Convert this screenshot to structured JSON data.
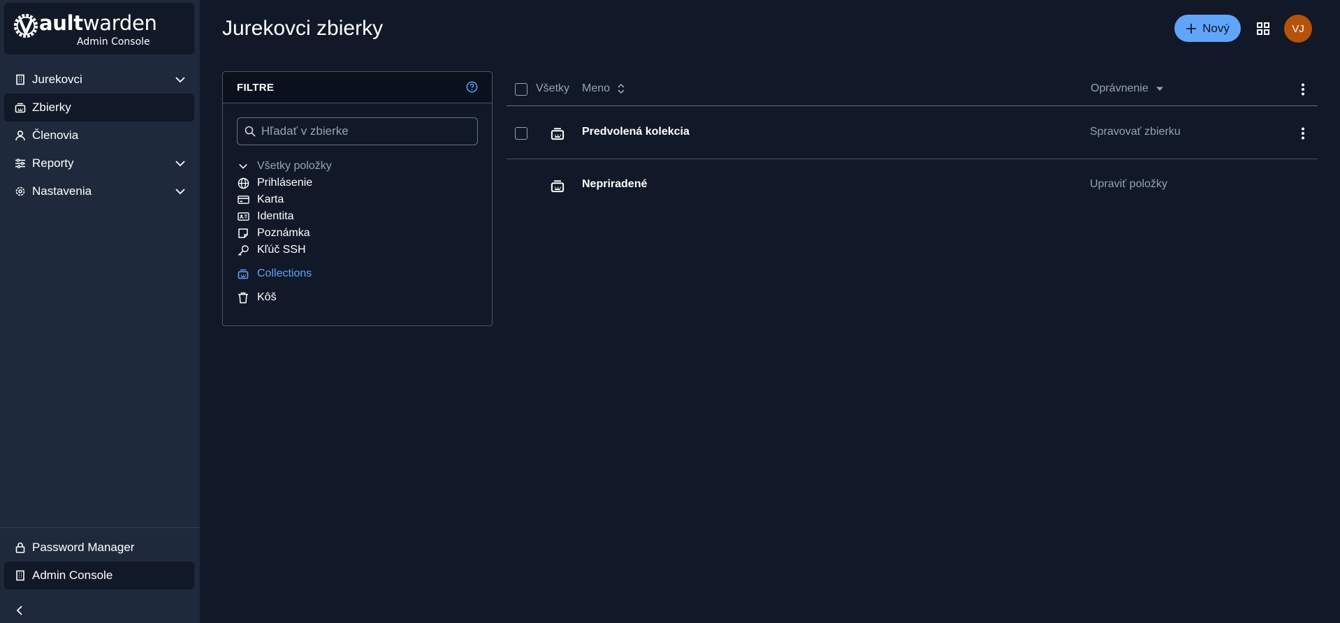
{
  "brand": {
    "name_bold": "ault",
    "name_rest": "warden",
    "subtitle": "Admin Console"
  },
  "sidebar": {
    "items": [
      {
        "label": "Jurekovci",
        "icon": "building-icon",
        "expandable": true
      },
      {
        "label": "Zbierky",
        "icon": "collection-icon",
        "active": true
      },
      {
        "label": "Členovia",
        "icon": "person-icon"
      },
      {
        "label": "Reporty",
        "icon": "sliders-icon",
        "expandable": true
      },
      {
        "label": "Nastavenia",
        "icon": "gear-icon",
        "expandable": true
      }
    ],
    "bottom": [
      {
        "label": "Password Manager",
        "icon": "lock-icon"
      },
      {
        "label": "Admin Console",
        "icon": "building-icon",
        "active": true
      }
    ]
  },
  "header": {
    "title": "Jurekovci zbierky",
    "new_button": "Nový",
    "avatar_initials": "VJ"
  },
  "filter": {
    "title": "FILTRE",
    "search_placeholder": "Hľadať v zbierke",
    "all_items": "Všetky položky",
    "types": [
      {
        "label": "Prihlásenie",
        "icon": "globe-icon"
      },
      {
        "label": "Karta",
        "icon": "card-icon"
      },
      {
        "label": "Identita",
        "icon": "id-card-icon"
      },
      {
        "label": "Poznámka",
        "icon": "note-icon"
      },
      {
        "label": "Kľúč SSH",
        "icon": "key-icon"
      }
    ],
    "collections": "Collections",
    "trash": "Kôš"
  },
  "table": {
    "col_all": "Všetky",
    "col_name": "Meno",
    "col_permission": "Oprávnenie",
    "rows": [
      {
        "name": "Predvolená kolekcia",
        "permission": "Spravovať zbierku"
      },
      {
        "name": "Nepriradené",
        "permission": "Upraviť položky"
      }
    ]
  },
  "colors": {
    "background": "#111827",
    "sidebar": "#1e293b",
    "accent": "#60a5fa",
    "avatar": "#b45309"
  }
}
